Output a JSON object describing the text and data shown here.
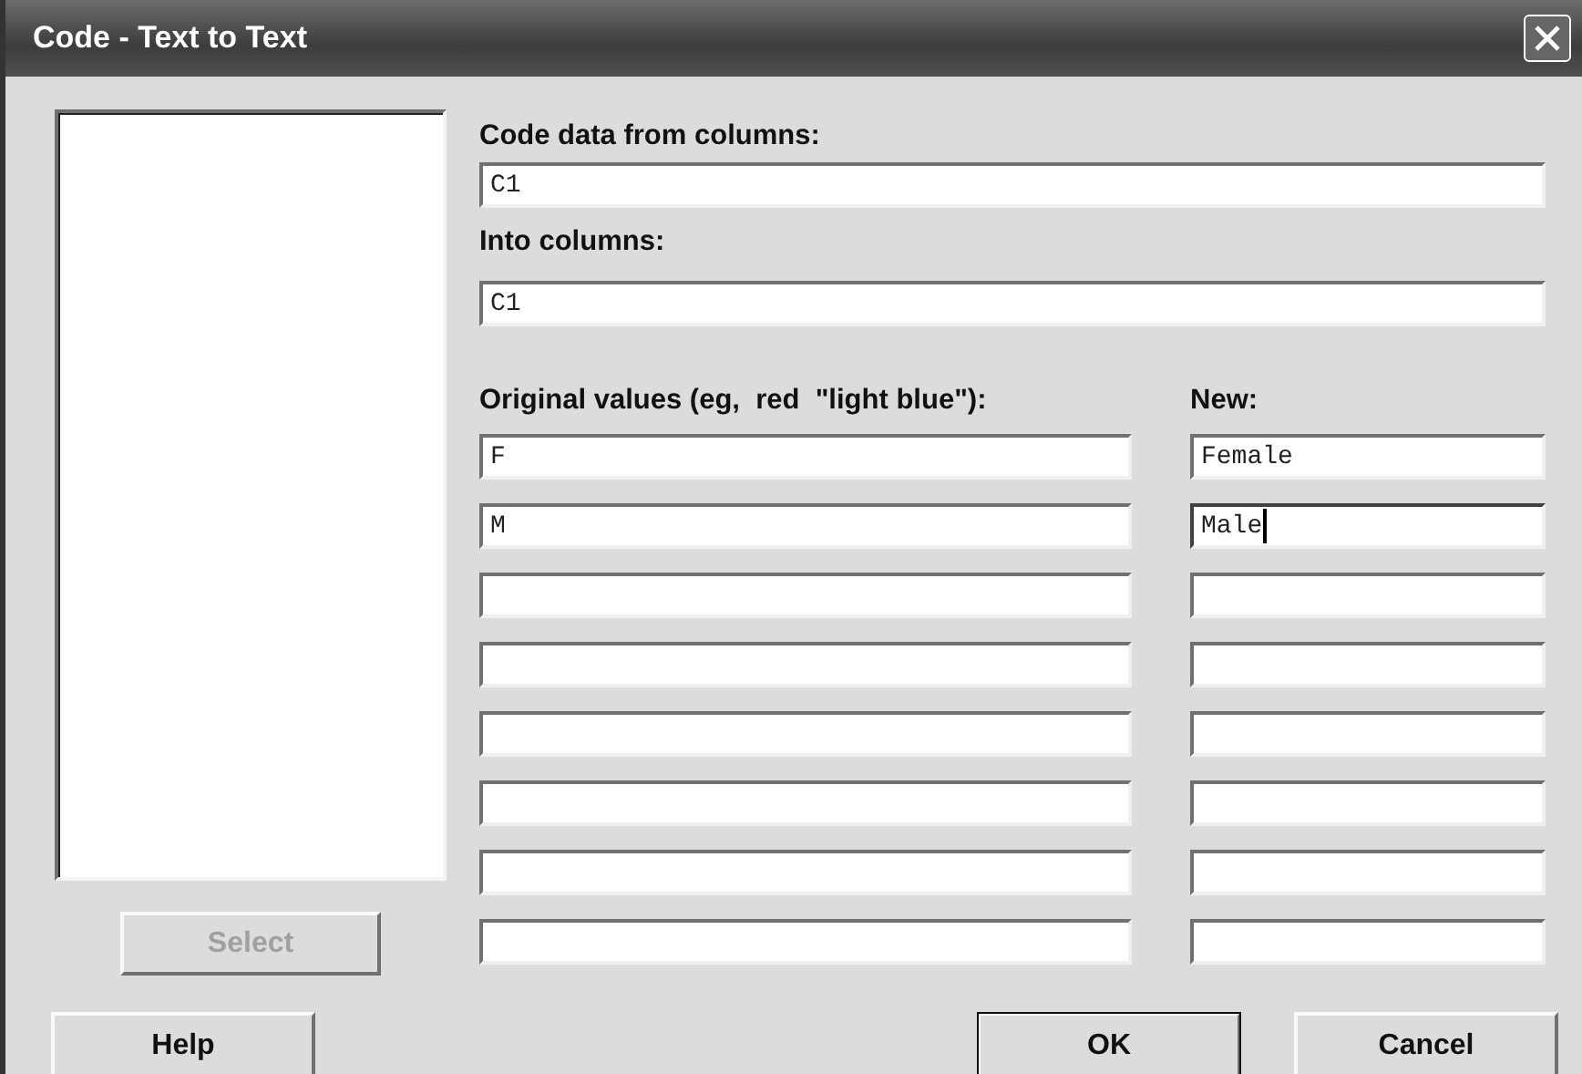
{
  "window": {
    "title": "Code - Text to Text"
  },
  "select_button": {
    "label": "Select",
    "disabled": true
  },
  "code_from": {
    "label": "Code data from columns:",
    "value": "C1"
  },
  "into": {
    "label": "Into columns:",
    "value": "C1"
  },
  "original_header": "Original values (eg,  red  \"light blue\"):",
  "new_header": "New:",
  "rows": [
    {
      "original": "F",
      "new": "Female",
      "focused": false
    },
    {
      "original": "M",
      "new": "Male",
      "focused": true
    },
    {
      "focused": false
    },
    {
      "focused": false
    },
    {
      "focused": false
    },
    {
      "focused": false
    },
    {
      "focused": false
    },
    {
      "focused": false
    }
  ],
  "buttons": [
    {
      "label": "Help",
      "default": false
    },
    {
      "label": "OK",
      "default": true
    },
    {
      "label": "Cancel",
      "default": false
    }
  ]
}
